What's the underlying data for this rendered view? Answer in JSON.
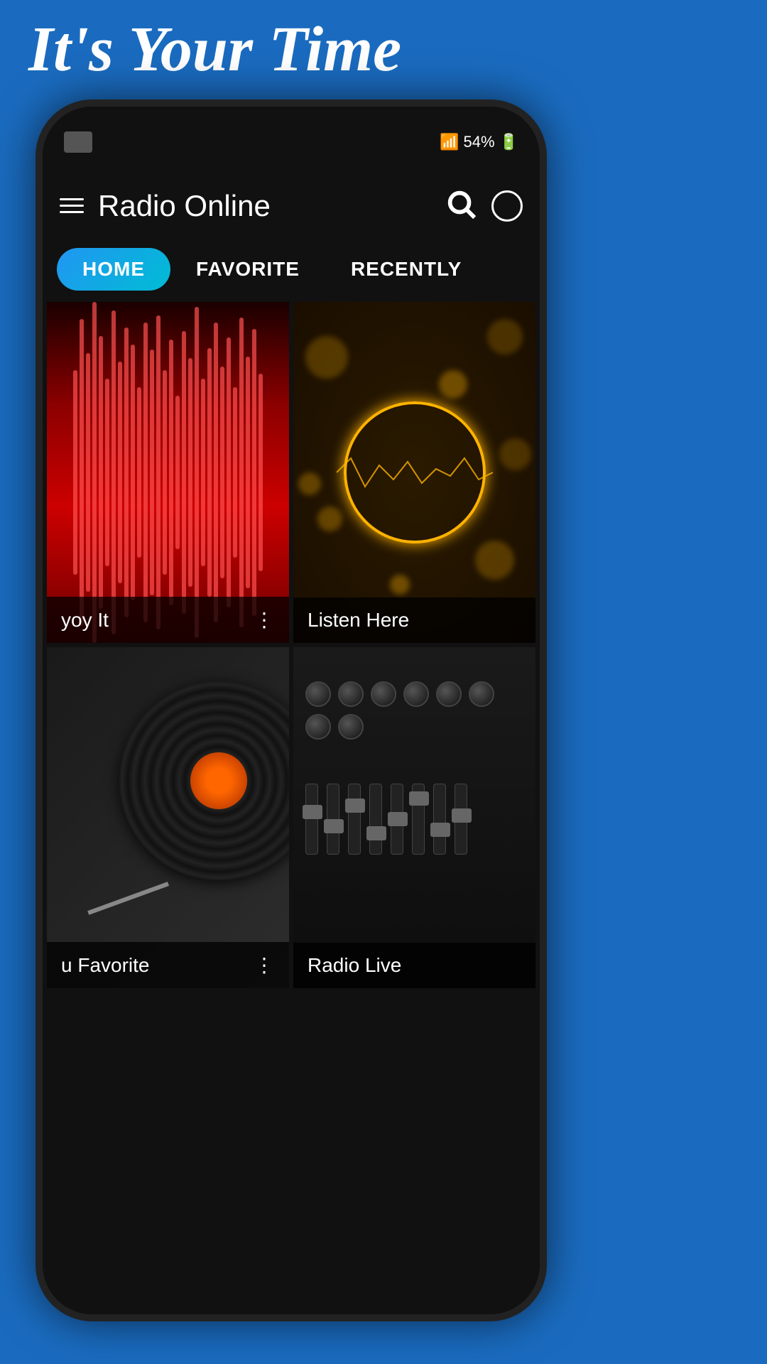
{
  "header": {
    "headline": "It's Your Time",
    "app_title": "Radio Online"
  },
  "status_bar": {
    "battery": "54%",
    "signal": "●●●●"
  },
  "tabs": [
    {
      "id": "home",
      "label": "HOME",
      "active": true
    },
    {
      "id": "favorite",
      "label": "FAVORITE",
      "active": false
    },
    {
      "id": "recently",
      "label": "RECENTLY",
      "active": false
    }
  ],
  "grid_items": [
    {
      "id": "enjoy-it",
      "label": "yoy It",
      "image_type": "red-wave"
    },
    {
      "id": "listen-here",
      "label": "Listen Here",
      "image_type": "gold-bokeh"
    },
    {
      "id": "u-favorite",
      "label": "u Favorite",
      "image_type": "vinyl"
    },
    {
      "id": "radio-live",
      "label": "Radio Live",
      "image_type": "mixer"
    }
  ],
  "icons": {
    "hamburger": "☰",
    "search": "🔍",
    "dots": "⋮"
  }
}
